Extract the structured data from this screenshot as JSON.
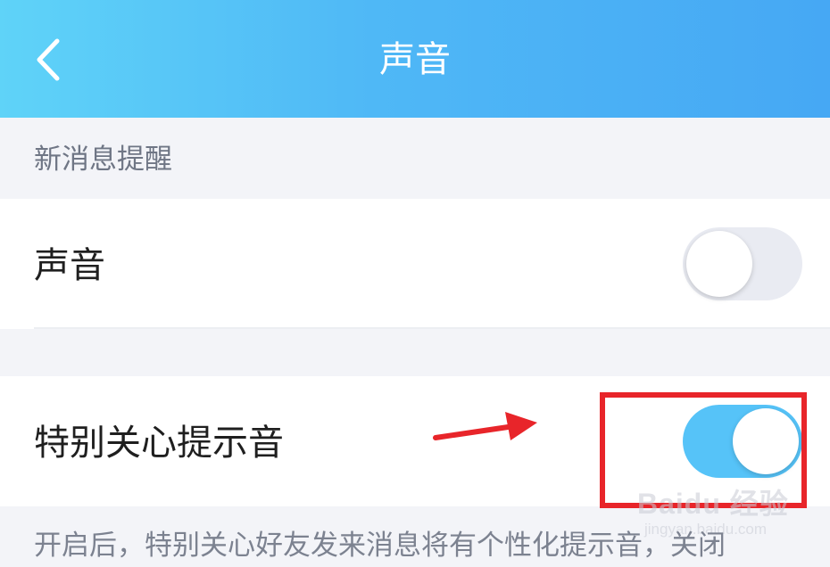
{
  "header": {
    "title": "声音",
    "back_icon": "chevron-left-icon"
  },
  "section": {
    "label": "新消息提醒"
  },
  "rows": {
    "sound": {
      "label": "声音",
      "toggle_on": false
    },
    "special": {
      "label": "特别关心提示音",
      "toggle_on": true
    }
  },
  "description": "开启后，特别关心好友发来消息将有个性化提示音，关闭",
  "watermark": {
    "brand": "Baidu 经验",
    "url": "jingyan.baidu.com"
  },
  "colors": {
    "header_gradient_start": "#5fd3f8",
    "header_gradient_end": "#46a8f4",
    "toggle_on": "#56c3f8",
    "toggle_off": "#e9ebf2",
    "annotation_red": "#e8252a"
  }
}
